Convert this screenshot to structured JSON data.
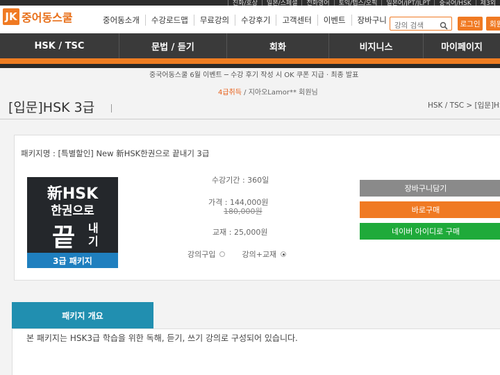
{
  "topbar": {
    "items": [
      "진화/호상",
      "일본/스페셜",
      "전화영어",
      "토익/텝스/오픽",
      "일본어/JPT/JLPT",
      "중국어/HSK",
      "제3외"
    ]
  },
  "header": {
    "logo_mark": "JK",
    "logo_text": "중어동스쿨",
    "nav": [
      "중어동소개",
      "수강로드맵",
      "무료강의",
      "수강후기",
      "고객센터",
      "이벤트",
      "장바구니"
    ],
    "search_placeholder": "강의 검색",
    "login_label": "로그인",
    "join_label": "회원"
  },
  "main_nav": [
    "HSK / TSC",
    "문법 / 듣기",
    "회화",
    "비지니스",
    "마이페이지"
  ],
  "notices": {
    "line1": "중국어동스쿨 6월 이벤트 ─ 수강 후기 작성 시 OK 쿠폰 지급 · 최종 발표",
    "line2_highlight": "4급취득",
    "line2_rest": " / 지아오Lamor** 회원님"
  },
  "page": {
    "title": "[입문]HSK 3급",
    "breadcrumb": "HSK / TSC > [입문]HSK"
  },
  "package": {
    "name": "패키지명 : [특별할인] New 新HSK한권으로 끝내기 3급",
    "cover": {
      "line1": "新HSK",
      "line2": "한권으로",
      "line3": "끝",
      "line4": "내기",
      "band": "3급 패키지"
    },
    "period": "수강기간 : 360일",
    "price": "가격 : 144,000원",
    "original_price": "180,000원",
    "textbook": "교재 : 25,000원",
    "option_lecture": "강의구입",
    "option_lecture_book": "강의+교재",
    "selected_option": "강의+교재"
  },
  "actions": {
    "cart": "장바구니담기",
    "buy": "바로구매",
    "naver": "네이버 아이디로 구매"
  },
  "overview": {
    "tab": "패키지 개요",
    "text": "본 패키지는 HSK3급 학습을 위한 독해, 듣기, 쓰기 강의로 구성되어 있습니다."
  },
  "colors": {
    "accent": "#f07a23",
    "nav_bg": "#3a3a3a",
    "cart_button": "#888888",
    "buy_button": "#f07a23",
    "naver_button": "#1faa3a",
    "overview_tab": "#218fb0",
    "cover_band": "#1f7fbf"
  }
}
